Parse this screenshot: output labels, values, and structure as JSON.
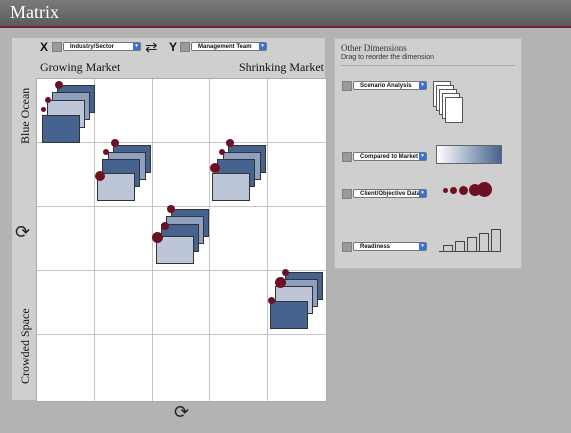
{
  "app": {
    "title": "Matrix"
  },
  "axes": {
    "x_label": "X",
    "x_select": "Industry/Sector",
    "y_label": "Y",
    "y_select": "Management Team"
  },
  "matrix": {
    "col_left": "Growing Market",
    "col_right": "Shrinking Market",
    "row_top": "Blue Ocean",
    "row_bottom": "Crowded Space"
  },
  "other_dimensions": {
    "title": "Other Dimensions",
    "subtitle": "Drag to reorder the dimension",
    "items": [
      {
        "label": "Scenario Analysis"
      },
      {
        "label": "Compared to Market"
      },
      {
        "label": "Client/Objective Data"
      },
      {
        "label": "Readiness"
      }
    ]
  },
  "colors": {
    "accent": "#6e1024",
    "card_dark": "#46628f",
    "card_light": "#bcc6d8"
  }
}
